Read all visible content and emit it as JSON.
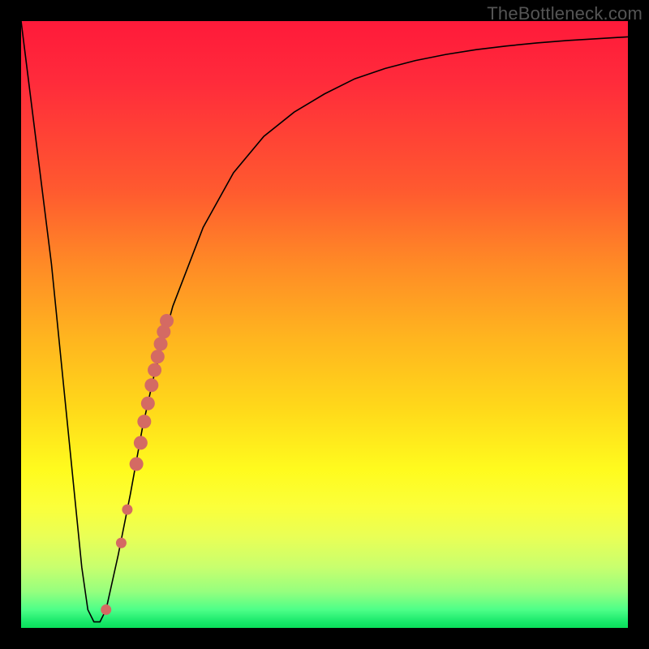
{
  "watermark": "TheBottleneck.com",
  "chart_data": {
    "type": "line",
    "title": "",
    "xlabel": "",
    "ylabel": "",
    "xlim": [
      0,
      100
    ],
    "ylim": [
      0,
      100
    ],
    "grid": false,
    "series": [
      {
        "name": "curve",
        "x": [
          0,
          5,
          8,
          10,
          11,
          12,
          13,
          14,
          16,
          18,
          20,
          22,
          25,
          30,
          35,
          40,
          45,
          50,
          55,
          60,
          65,
          70,
          75,
          80,
          85,
          90,
          95,
          100
        ],
        "y": [
          100,
          60,
          30,
          10,
          3,
          1,
          1,
          3,
          12,
          22,
          33,
          42,
          53,
          66,
          75,
          81,
          85,
          88,
          90.5,
          92.2,
          93.5,
          94.5,
          95.3,
          95.9,
          96.4,
          96.8,
          97.1,
          97.4
        ]
      }
    ],
    "markers": [
      {
        "x": 14.0,
        "y": 3.0
      },
      {
        "x": 16.5,
        "y": 14.0
      },
      {
        "x": 17.5,
        "y": 19.5
      },
      {
        "x": 19.0,
        "y": 27.0
      },
      {
        "x": 19.7,
        "y": 30.5
      },
      {
        "x": 20.3,
        "y": 34.0
      },
      {
        "x": 20.9,
        "y": 37.0
      },
      {
        "x": 21.5,
        "y": 40.0
      },
      {
        "x": 22.0,
        "y": 42.5
      },
      {
        "x": 22.5,
        "y": 44.7
      },
      {
        "x": 23.0,
        "y": 46.8
      },
      {
        "x": 23.5,
        "y": 48.8
      },
      {
        "x": 24.0,
        "y": 50.6
      }
    ],
    "marker_color": "#d46a63",
    "line_color": "#000000"
  }
}
